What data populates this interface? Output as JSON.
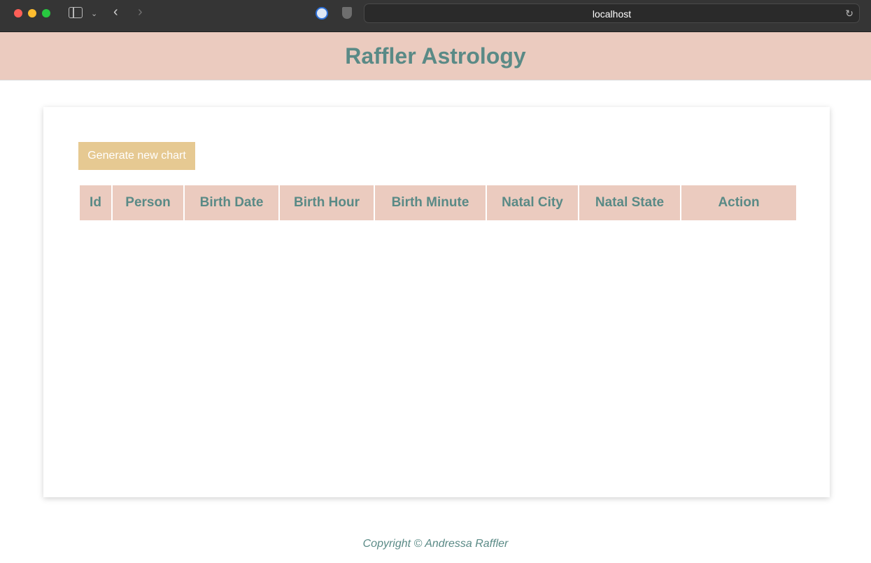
{
  "browser": {
    "url": "localhost"
  },
  "header": {
    "title": "Raffler Astrology"
  },
  "main": {
    "generate_button_label": "Generate new chart",
    "table": {
      "columns": [
        "Id",
        "Person",
        "Birth Date",
        "Birth Hour",
        "Birth Minute",
        "Natal City",
        "Natal State",
        "Action"
      ],
      "rows": []
    }
  },
  "footer": {
    "copyright": "Copyright © Andressa Raffler"
  },
  "colors": {
    "header_bg": "#ebcbbf",
    "accent_text": "#5a8a86",
    "button_bg": "#e6c992"
  },
  "icons": {
    "browser": [
      "close-dot-icon",
      "minimize-dot-icon",
      "zoom-dot-icon",
      "sidebar-icon",
      "chevron-down-icon",
      "back-arrow-icon",
      "forward-arrow-icon",
      "password-manager-icon",
      "shield-icon",
      "reload-icon"
    ]
  }
}
